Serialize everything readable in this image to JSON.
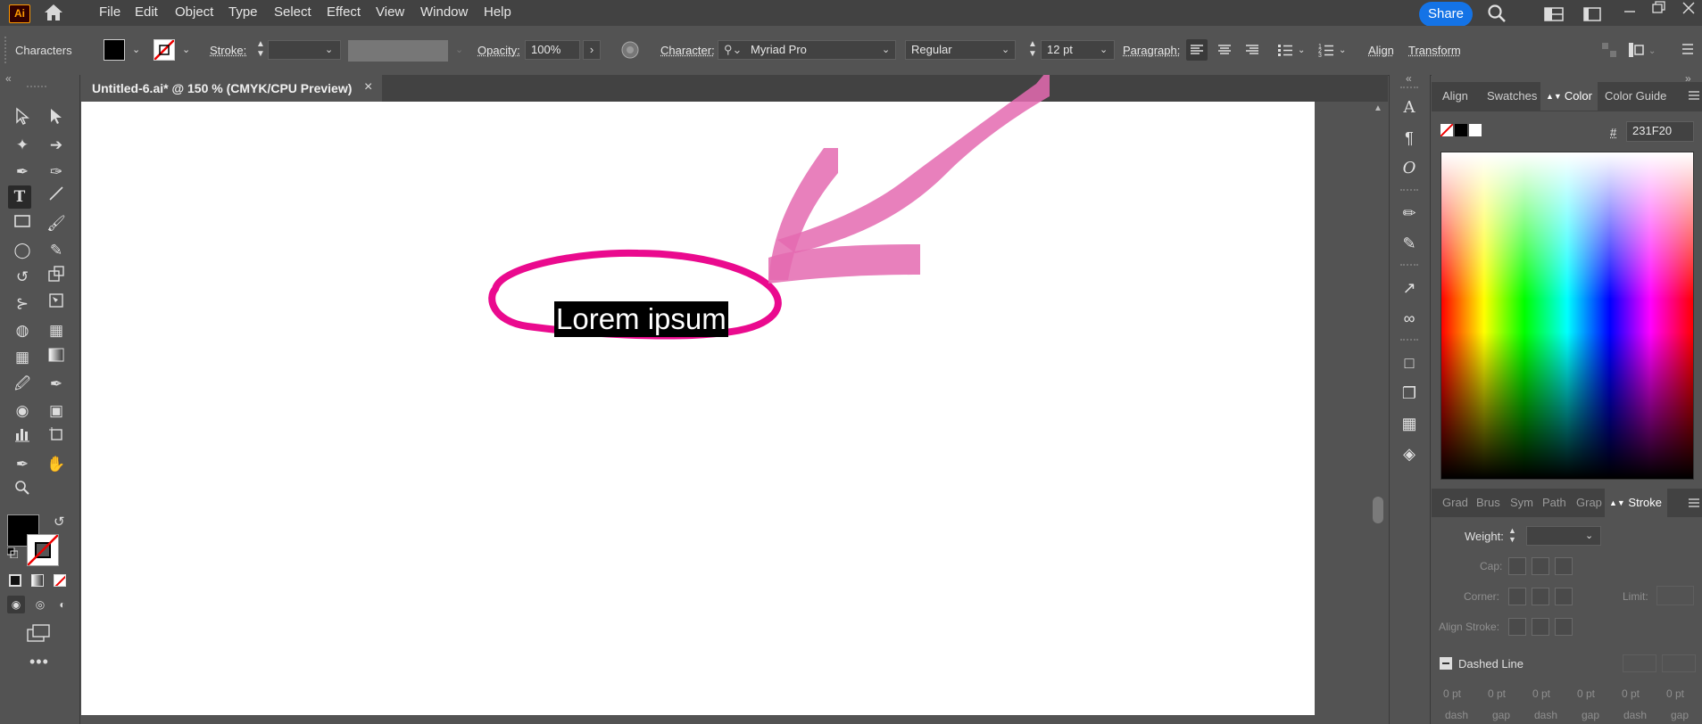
{
  "app": {
    "logo": "Ai"
  },
  "menu": [
    "File",
    "Edit",
    "Object",
    "Type",
    "Select",
    "Effect",
    "View",
    "Window",
    "Help"
  ],
  "share_label": "Share",
  "controlbar": {
    "context": "Characters",
    "stroke_label": "Stroke:",
    "opacity_label": "Opacity:",
    "opacity_value": "100%",
    "character_label": "Character:",
    "font_family": "Myriad Pro",
    "font_style": "Regular",
    "font_size": "12 pt",
    "paragraph_label": "Paragraph:",
    "align_link": "Align",
    "transform_link": "Transform"
  },
  "document_tab": {
    "title": "Untitled-6.ai* @ 150 % (CMYK/CPU Preview)",
    "close": "×"
  },
  "canvas": {
    "text": "Lorem ipsum",
    "annotation_color": "#e8007f"
  },
  "color_panel": {
    "tabs": [
      "Align",
      "Swatches",
      "Color",
      "Color Guide"
    ],
    "active_tab": "Color",
    "hex_label": "#",
    "hex_value": "231F20"
  },
  "stroke_panel": {
    "tabs": [
      "Grad",
      "Brus",
      "Sym",
      "Path",
      "Grap",
      "Stroke"
    ],
    "active_tab": "Stroke",
    "weight_label": "Weight:",
    "cap_label": "Cap:",
    "corner_label": "Corner:",
    "limit_label": "Limit:",
    "align_stroke_label": "Align Stroke:",
    "dashed_line_label": "Dashed Line",
    "dash_values": [
      "0 pt",
      "0 pt",
      "0 pt",
      "0 pt",
      "0 pt",
      "0 pt"
    ],
    "dash_captions": [
      "dash",
      "gap",
      "dash",
      "gap",
      "dash",
      "gap"
    ]
  }
}
